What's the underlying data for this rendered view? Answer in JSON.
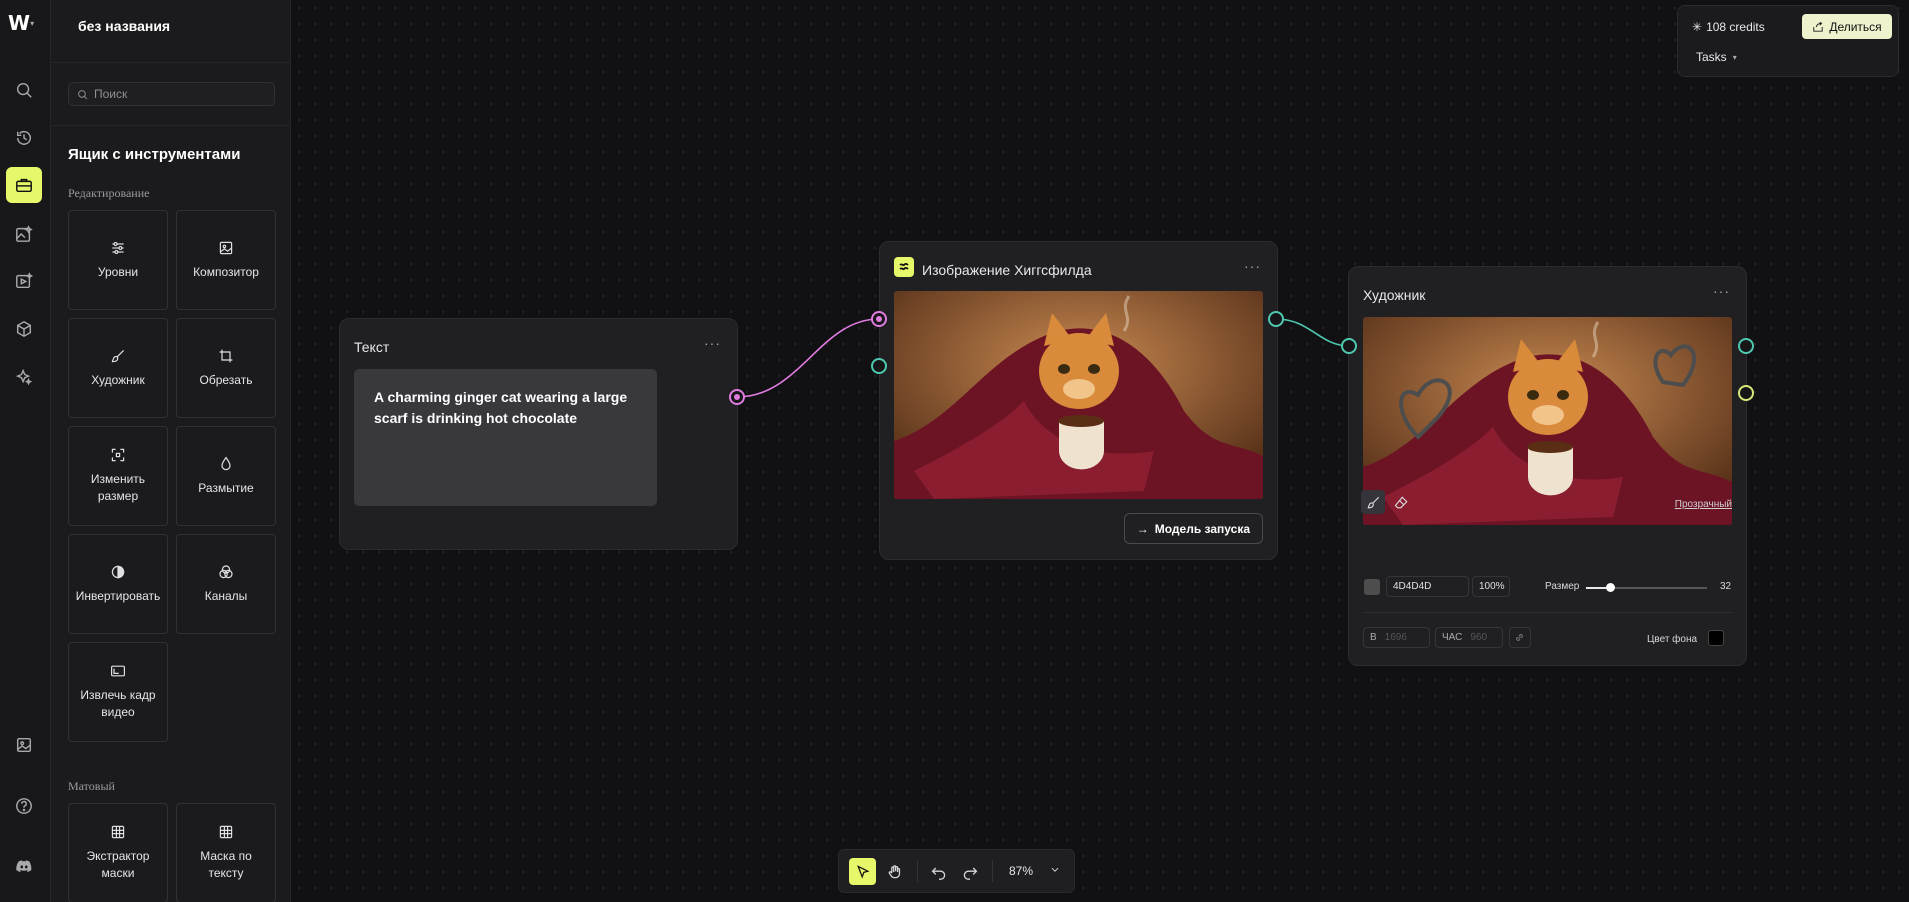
{
  "app": {
    "project_name": "без названия"
  },
  "rail": {
    "icons": [
      "search-icon",
      "history-icon",
      "toolbox-icon",
      "image-edit-icon",
      "video-icon",
      "cube-icon",
      "sparkle-icon",
      "gallery-icon",
      "help-icon",
      "discord-icon"
    ]
  },
  "sidebar": {
    "search_placeholder": "Поиск",
    "heading": "Ящик с инструментами",
    "section_editing": "Редактирование",
    "section_matte": "Матовый",
    "tools": [
      {
        "label": "Уровни",
        "icon": "sliders-icon"
      },
      {
        "label": "Композитор",
        "icon": "compositor-icon"
      },
      {
        "label": "Художник",
        "icon": "brush-icon"
      },
      {
        "label": "Обрезать",
        "icon": "crop-icon"
      },
      {
        "label": "Изменить размер",
        "icon": "resize-icon"
      },
      {
        "label": "Размытие",
        "icon": "blur-drop-icon"
      },
      {
        "label": "Инвертировать",
        "icon": "invert-icon"
      },
      {
        "label": "Каналы",
        "icon": "channels-icon"
      },
      {
        "label": "Извлечь кадр видео",
        "icon": "frame-extract-icon"
      }
    ],
    "matte_tools": [
      {
        "label": "Экстрактор маски",
        "icon": "mask-extract-icon"
      },
      {
        "label": "Маска по тексту",
        "icon": "text-mask-icon"
      }
    ]
  },
  "nodes": {
    "text": {
      "title": "Текст",
      "menu": "···",
      "prompt": "A charming ginger cat wearing a large scarf is drinking hot chocolate"
    },
    "image": {
      "title": "Изображение Хиггсфилда",
      "menu": "···",
      "run_label": "Модель запуска"
    },
    "painter": {
      "title": "Художник",
      "menu": "···",
      "transparent_label": "Прозрачный",
      "color_hex": "4D4D4D",
      "opacity": "100%",
      "size_label": "Размер",
      "size_value": "32",
      "size_fraction": 0.2,
      "width_label": "В",
      "width_placeholder": "1696",
      "height_label": "ЧАС",
      "height_placeholder": "960",
      "bg_label": "Цвет фона",
      "bg_color": "#000000",
      "brush_color": "#4d4d4d"
    }
  },
  "topbar": {
    "credits": "108 credits",
    "share_label": "Делиться",
    "tasks_label": "Tasks"
  },
  "toolbar": {
    "zoom": "87%"
  },
  "colors": {
    "accent": "#e6f86a",
    "text_port": "#e07be0",
    "image_port": "#4fc9b0",
    "mask_port": "#d8e87a"
  }
}
